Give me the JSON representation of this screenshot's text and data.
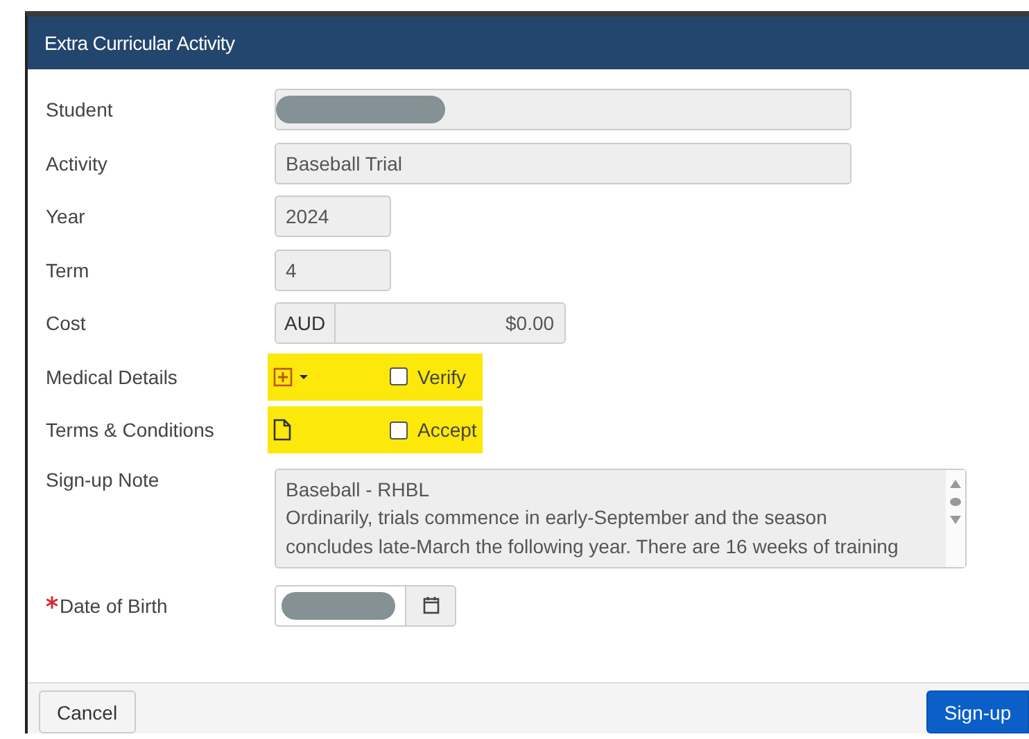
{
  "window": {
    "title": "Extra Curricular Activity"
  },
  "fields": [
    {
      "kind": "redacted",
      "label": "Student"
    },
    {
      "kind": "text",
      "label": "Activity",
      "value": "Baseball Trial"
    },
    {
      "kind": "short",
      "label": "Year",
      "value": "2024"
    },
    {
      "kind": "short",
      "label": "Term",
      "value": "4"
    },
    {
      "kind": "currency",
      "label": "Cost",
      "prefix": "AUD",
      "value": "$0.00"
    },
    {
      "kind": "medical",
      "label": "Medical Details",
      "checkbox": "Verify",
      "checked": false,
      "highlighted": true
    },
    {
      "kind": "document",
      "label": "Terms & Conditions",
      "checkbox": "Accept",
      "checked": false,
      "highlighted": true
    },
    {
      "kind": "note",
      "label": "Sign-up Note",
      "lines": [
        "Baseball - RHBL",
        "Ordinarily, trials commence in early-September and the season",
        "concludes late-March the following year. There are 16 weeks of training"
      ]
    },
    {
      "kind": "date",
      "label": "Date of Birth",
      "required": true
    }
  ],
  "buttons": [
    {
      "label": "Cancel",
      "kind": "default"
    },
    {
      "label": "Sign-up",
      "kind": "primary"
    }
  ]
}
